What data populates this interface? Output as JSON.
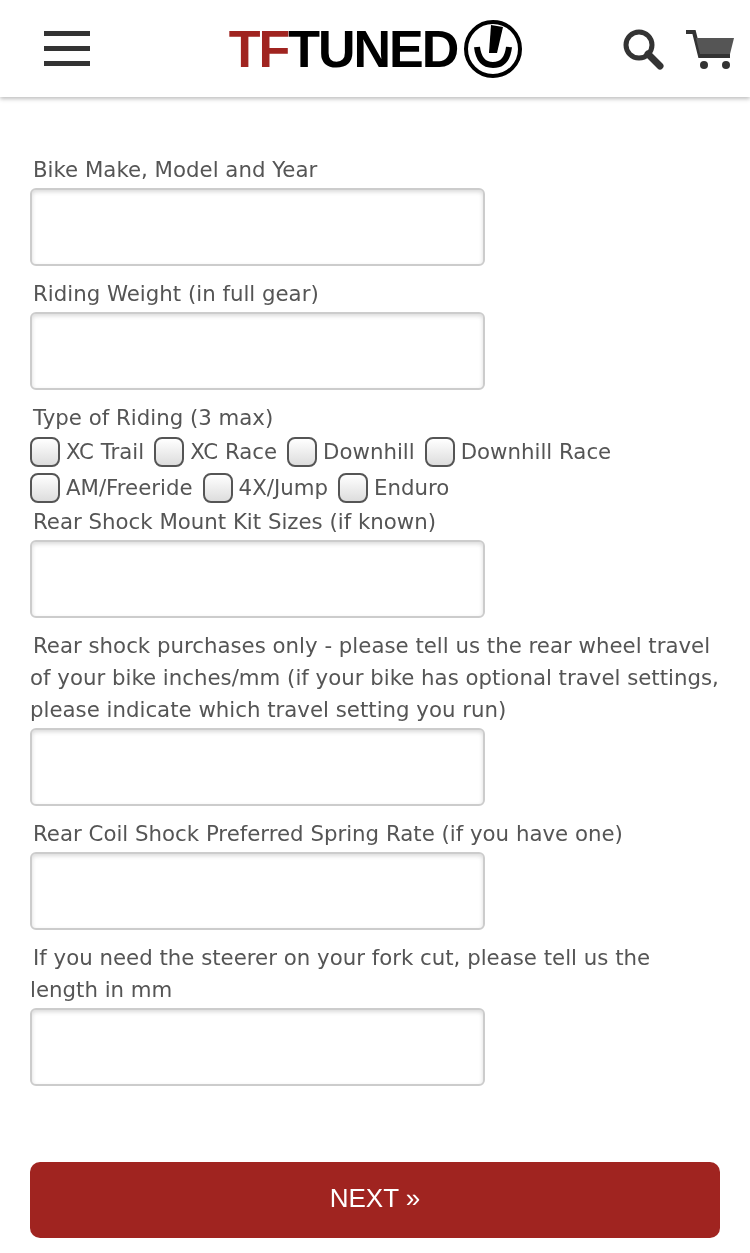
{
  "header": {
    "logo": {
      "accent": "TF",
      "text": "TUNED"
    }
  },
  "form": {
    "fields": [
      {
        "kind": "text",
        "label": "Bike Make, Model and Year"
      },
      {
        "kind": "text",
        "label": "Riding Weight (in full gear)"
      },
      {
        "kind": "checkboxes",
        "label": "Type of Riding (3 max)",
        "options": [
          {
            "label": "XC Trail",
            "checked": false
          },
          {
            "label": "XC Race",
            "checked": false
          },
          {
            "label": "Downhill",
            "checked": false
          },
          {
            "label": "Downhill Race",
            "checked": false
          },
          {
            "label": "AM/Freeride",
            "checked": false
          },
          {
            "label": "4X/Jump",
            "checked": false
          },
          {
            "label": "Enduro",
            "checked": false
          }
        ]
      },
      {
        "kind": "text",
        "label": "Rear Shock Mount Kit Sizes (if known)"
      },
      {
        "kind": "text",
        "label": "Rear shock purchases only - please tell us the rear wheel travel of your bike inches/mm (if your bike has optional travel settings, please indicate which travel setting you run)"
      },
      {
        "kind": "text",
        "label": "Rear Coil Shock Preferred Spring Rate (if you have one)"
      },
      {
        "kind": "text",
        "label": "If you need the steerer on your fork cut, please tell us the length in mm"
      }
    ],
    "submit": "NEXT »"
  }
}
